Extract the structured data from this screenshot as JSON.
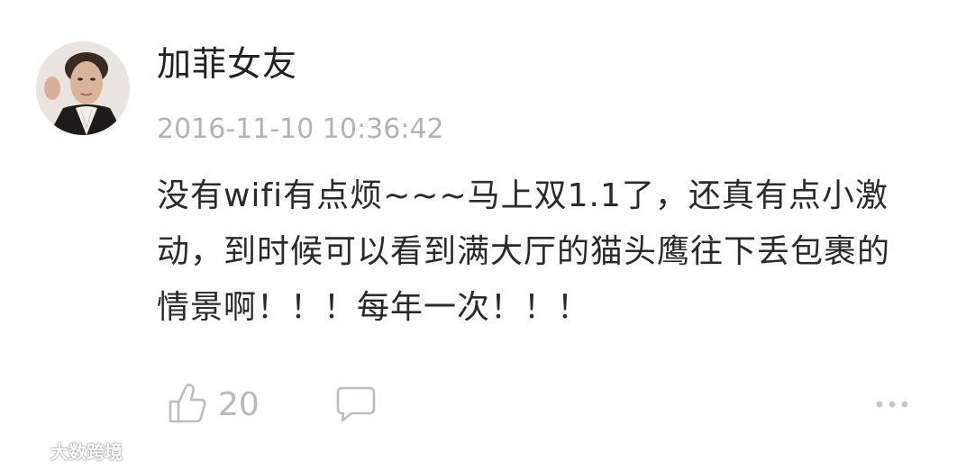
{
  "post": {
    "username": "加菲女友",
    "timestamp": "2016-11-10 10:36:42",
    "content": "没有wifi有点烦~~~马上双1.1了，还真有点小激动，到时候可以看到满大厅的猫头鹰往下丢包裹的情景啊！！！每年一次！！！"
  },
  "actions": {
    "like_icon": "thumbs-up-icon",
    "like_count": "20",
    "comment_icon": "comment-icon",
    "more_icon": "more-icon"
  },
  "watermark": {
    "text": "大数跨境"
  }
}
